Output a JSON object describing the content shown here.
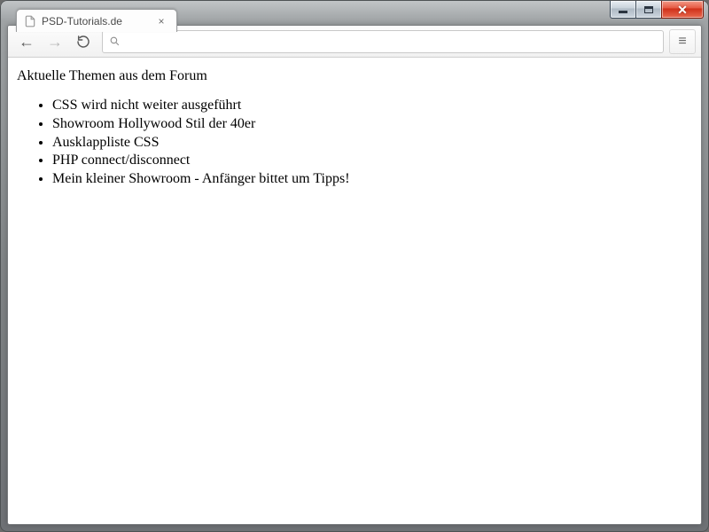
{
  "window": {
    "tab_title": "PSD-Tutorials.de",
    "omnibox_value": ""
  },
  "page": {
    "heading": "Aktuelle Themen aus dem Forum",
    "items": [
      "CSS wird nicht weiter ausgeführt",
      "Showroom Hollywood Stil der 40er",
      "Ausklappliste CSS",
      "PHP connect/disconnect",
      "Mein kleiner Showroom - Anfänger bittet um Tipps!"
    ]
  }
}
